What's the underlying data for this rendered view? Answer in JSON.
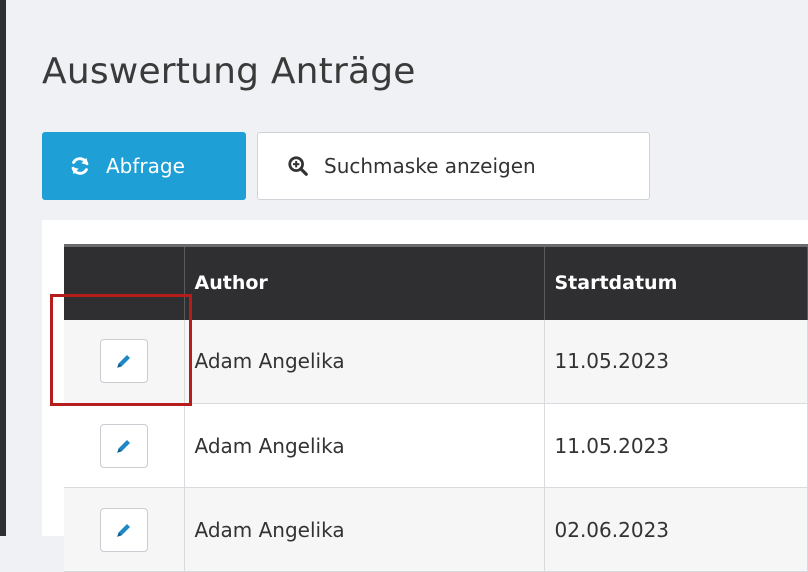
{
  "page": {
    "title": "Auswertung Anträge"
  },
  "toolbar": {
    "query_label": "Abfrage",
    "query_icon": "refresh-icon",
    "search_label": "Suchmaske anzeigen",
    "search_icon": "zoom-search-icon"
  },
  "table": {
    "columns": [
      "",
      "Author",
      "Startdatum"
    ],
    "rows": [
      {
        "author": "Adam Angelika",
        "start": "11.05.2023"
      },
      {
        "author": "Adam Angelika",
        "start": "11.05.2023"
      },
      {
        "author": "Adam Angelika",
        "start": "02.06.2023"
      }
    ],
    "edit_icon": "pencil-icon"
  },
  "colors": {
    "primary": "#1e9fd6",
    "header_bg": "#2f2f31",
    "highlight": "#b51c1c"
  }
}
